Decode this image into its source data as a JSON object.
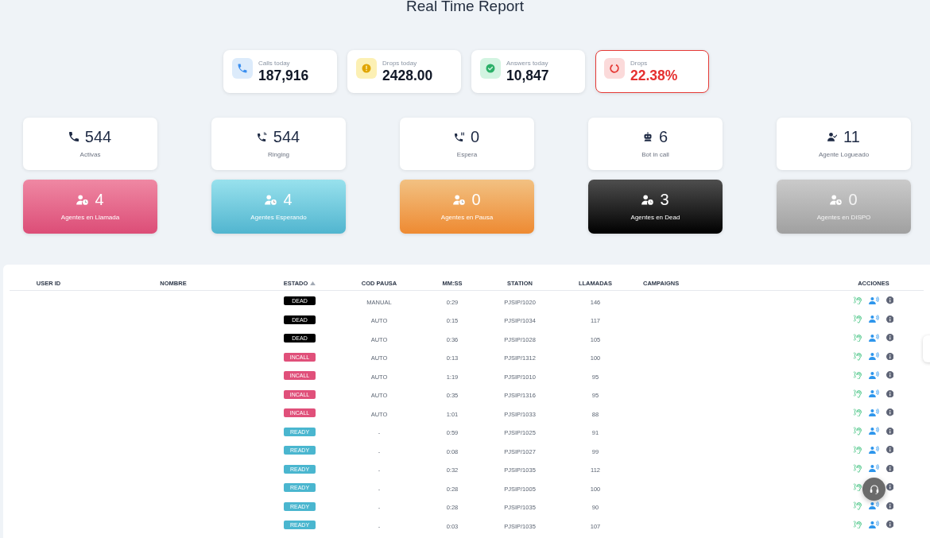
{
  "title": "Real Time Report",
  "summary": [
    {
      "kind": "calls",
      "label": "Calls today",
      "value": "187,916",
      "alert": false
    },
    {
      "kind": "drops",
      "label": "Drops today",
      "value": "2428.00",
      "alert": false
    },
    {
      "kind": "answers",
      "label": "Answers today",
      "value": "10,847",
      "alert": false
    },
    {
      "kind": "rate",
      "label": "Drops",
      "value": "22.38%",
      "alert": true
    }
  ],
  "stats": [
    {
      "kind": "active",
      "value": "544",
      "label": "Activas"
    },
    {
      "kind": "ringing",
      "value": "544",
      "label": "Ringing"
    },
    {
      "kind": "waiting",
      "value": "0",
      "label": "Espera"
    },
    {
      "kind": "bot",
      "value": "6",
      "label": "Bot in call"
    },
    {
      "kind": "logged",
      "value": "11",
      "label": "Agente Logueado"
    }
  ],
  "agents": [
    {
      "kind": "incall",
      "value": "4",
      "label": "Agentes en Llamada"
    },
    {
      "kind": "waiting",
      "value": "4",
      "label": "Agentes Esperando"
    },
    {
      "kind": "paused",
      "value": "0",
      "label": "Agentes en Pausa"
    },
    {
      "kind": "dead",
      "value": "3",
      "label": "Agentes en Dead"
    },
    {
      "kind": "dispo",
      "value": "0",
      "label": "Agentes en DISPO"
    }
  ],
  "table": {
    "columns": [
      {
        "label": "USER ID",
        "sorted": false
      },
      {
        "label": "NOMBRE",
        "sorted": false
      },
      {
        "label": "ESTADO",
        "sorted": true
      },
      {
        "label": "COD PAUSA",
        "sorted": false
      },
      {
        "label": "MM:SS",
        "sorted": false
      },
      {
        "label": "STATION",
        "sorted": false
      },
      {
        "label": "LLAMADAS",
        "sorted": false
      },
      {
        "label": "CAMPAIGNS",
        "sorted": false
      },
      {
        "label": "ACCIONES",
        "sorted": false
      }
    ],
    "rows": [
      {
        "estado": "DEAD",
        "color": "#000000",
        "cod_pausa": "MANUAL",
        "mm_ss": "0:29",
        "station": "PJSIP/1020",
        "llamadas": "146"
      },
      {
        "estado": "DEAD",
        "color": "#000000",
        "cod_pausa": "AUTO",
        "mm_ss": "0:15",
        "station": "PJSIP/1034",
        "llamadas": "117"
      },
      {
        "estado": "DEAD",
        "color": "#000000",
        "cod_pausa": "AUTO",
        "mm_ss": "0:36",
        "station": "PJSIP/1028",
        "llamadas": "105"
      },
      {
        "estado": "INCALL",
        "color": "#e0507a",
        "cod_pausa": "AUTO",
        "mm_ss": "0:13",
        "station": "PJSIP/1312",
        "llamadas": "100"
      },
      {
        "estado": "INCALL",
        "color": "#e0507a",
        "cod_pausa": "AUTO",
        "mm_ss": "1:19",
        "station": "PJSIP/1010",
        "llamadas": "95"
      },
      {
        "estado": "INCALL",
        "color": "#e0507a",
        "cod_pausa": "AUTO",
        "mm_ss": "0:35",
        "station": "PJSIP/1316",
        "llamadas": "95"
      },
      {
        "estado": "INCALL",
        "color": "#e0507a",
        "cod_pausa": "AUTO",
        "mm_ss": "1:01",
        "station": "PJSIP/1033",
        "llamadas": "88"
      },
      {
        "estado": "READY",
        "color": "#4ab6cf",
        "cod_pausa": "-",
        "mm_ss": "0:59",
        "station": "PJSIP/1025",
        "llamadas": "91"
      },
      {
        "estado": "READY",
        "color": "#4ab6cf",
        "cod_pausa": "-",
        "mm_ss": "0:08",
        "station": "PJSIP/1027",
        "llamadas": "99"
      },
      {
        "estado": "READY",
        "color": "#4ab6cf",
        "cod_pausa": "-",
        "mm_ss": "0:32",
        "station": "PJSIP/1035",
        "llamadas": "112"
      },
      {
        "estado": "READY",
        "color": "#4ab6cf",
        "cod_pausa": "-",
        "mm_ss": "0:28",
        "station": "PJSIP/1005",
        "llamadas": "100"
      },
      {
        "estado": "READY",
        "color": "#4ab6cf",
        "cod_pausa": "-",
        "mm_ss": "0:28",
        "station": "PJSIP/1035",
        "llamadas": "90"
      },
      {
        "estado": "READY",
        "color": "#4ab6cf",
        "cod_pausa": "-",
        "mm_ss": "0:03",
        "station": "PJSIP/1035",
        "llamadas": "107"
      }
    ]
  }
}
